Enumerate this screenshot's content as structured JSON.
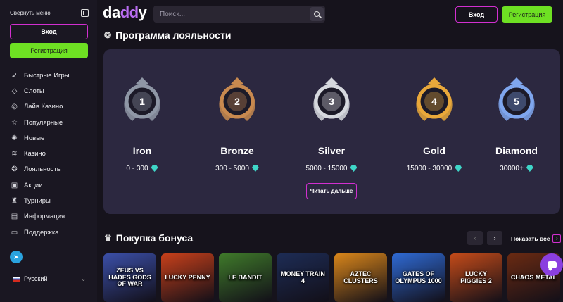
{
  "sidebar": {
    "collapse_label": "Свернуть меню",
    "login_label": "Вход",
    "register_label": "Регистрация",
    "items": [
      {
        "label": "Быстрые Игры",
        "icon": "rocket-icon"
      },
      {
        "label": "Слоты",
        "icon": "diamond-icon"
      },
      {
        "label": "Лайв Казино",
        "icon": "chip-icon"
      },
      {
        "label": "Популярные",
        "icon": "star-icon"
      },
      {
        "label": "Новые",
        "icon": "new-badge-icon"
      },
      {
        "label": "Казино",
        "icon": "coins-icon"
      },
      {
        "label": "Лояльность",
        "icon": "medal-icon"
      },
      {
        "label": "Акции",
        "icon": "gift-icon"
      },
      {
        "label": "Турниры",
        "icon": "trophy-icon"
      },
      {
        "label": "Информация",
        "icon": "info-icon"
      },
      {
        "label": "Поддержка",
        "icon": "chat-support-icon"
      }
    ],
    "language": "Русский"
  },
  "header": {
    "logo": {
      "part1": "da",
      "part2": "dd",
      "part3": "y"
    },
    "search_placeholder": "Поиск...",
    "login_label": "Вход",
    "register_label": "Регистрация"
  },
  "loyalty": {
    "title": "Программа лояльности",
    "read_more": "Читать дальше",
    "tiers": [
      {
        "name": "Iron",
        "range": "0 - 300",
        "number": "1",
        "color": "#8f97a6"
      },
      {
        "name": "Bronze",
        "range": "300 - 5000",
        "number": "2",
        "color": "#c8894f"
      },
      {
        "name": "Silver",
        "range": "5000 - 15000",
        "number": "3",
        "color": "#d6d8de"
      },
      {
        "name": "Gold",
        "range": "15000 - 30000",
        "number": "4",
        "color": "#e9a83a"
      },
      {
        "name": "Diamond",
        "range": "30000+",
        "number": "5",
        "color": "#7fa6ee"
      }
    ]
  },
  "bonus": {
    "title": "Покупка бонуса",
    "show_all": "Показать все",
    "games": [
      {
        "title": "ZEUS VS HADES GODS OF WAR",
        "bg": "#3b4fa8"
      },
      {
        "title": "LUCKY PENNY",
        "bg": "#c8401a"
      },
      {
        "title": "LE BANDIT",
        "bg": "#3f7a2a"
      },
      {
        "title": "MONEY TRAIN 4",
        "bg": "#1d2c55"
      },
      {
        "title": "AZTEC CLUSTERS",
        "bg": "#d9861a"
      },
      {
        "title": "GATES OF OLYMPUS 1000",
        "bg": "#2f6ad4"
      },
      {
        "title": "LUCKY PIGGIES 2",
        "bg": "#c44b19"
      },
      {
        "title": "CHAOS METAL",
        "bg": "#6a2a12"
      }
    ]
  },
  "colors": {
    "accent_pink": "#d22fd0",
    "accent_green": "#6ee023",
    "panel": "#2c2840",
    "gem": "#3fd6c8"
  }
}
